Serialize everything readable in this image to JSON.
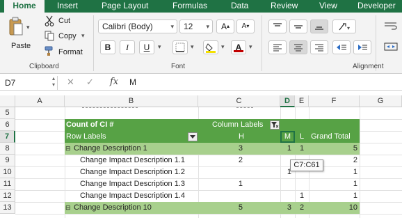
{
  "ribbon_tabs": [
    {
      "label": "Home",
      "active": true
    },
    {
      "label": "Insert"
    },
    {
      "label": "Page Layout"
    },
    {
      "label": "Formulas"
    },
    {
      "label": "Data"
    },
    {
      "label": "Review"
    },
    {
      "label": "View"
    },
    {
      "label": "Developer"
    }
  ],
  "clipboard": {
    "paste": "Paste",
    "cut": "Cut",
    "copy": "Copy",
    "format": "Format",
    "group": "Clipboard"
  },
  "font": {
    "family": "Calibri (Body)",
    "size": "12",
    "bold": "B",
    "italic": "I",
    "underline": "U",
    "color_letter": "A",
    "group": "Font"
  },
  "alignment": {
    "group": "Alignment"
  },
  "formula_bar": {
    "name_box": "D7",
    "fx": "fx",
    "value": "M"
  },
  "columns": [
    "A",
    "B",
    "C",
    "D",
    "E",
    "F",
    "G"
  ],
  "rows": [
    "5",
    "6",
    "7",
    "8",
    "9",
    "10",
    "11",
    "12",
    "13"
  ],
  "pivot": {
    "count_label": "Count of CI #",
    "column_labels": "Column Labels",
    "row_labels": "Row Labels",
    "h_header": "H",
    "m_header": "M",
    "l_header": "L",
    "grand_total_header": "Grand Total",
    "rows": [
      {
        "label": "Change Description 1",
        "h": "3",
        "m": "1",
        "l": "1",
        "total": "5"
      },
      {
        "label": "Change Impact Description 1.1",
        "h": "2",
        "m": "",
        "l": "",
        "total": "2"
      },
      {
        "label": "Change Impact Description 1.2",
        "h": "",
        "m": "1",
        "l": "",
        "total": "1"
      },
      {
        "label": "Change Impact Description 1.3",
        "h": "1",
        "m": "",
        "l": "",
        "total": "1"
      },
      {
        "label": "Change Impact Description 1.4",
        "h": "",
        "m": "",
        "l": "1",
        "total": "1"
      },
      {
        "label": "Change Description 10",
        "h": "5",
        "m": "3",
        "l": "2",
        "total": "10"
      }
    ]
  },
  "tooltip": "C7:C61",
  "colors": {
    "accent": "#1f7244",
    "pivot_header": "#57a245",
    "pivot_group": "#a8d08d"
  }
}
